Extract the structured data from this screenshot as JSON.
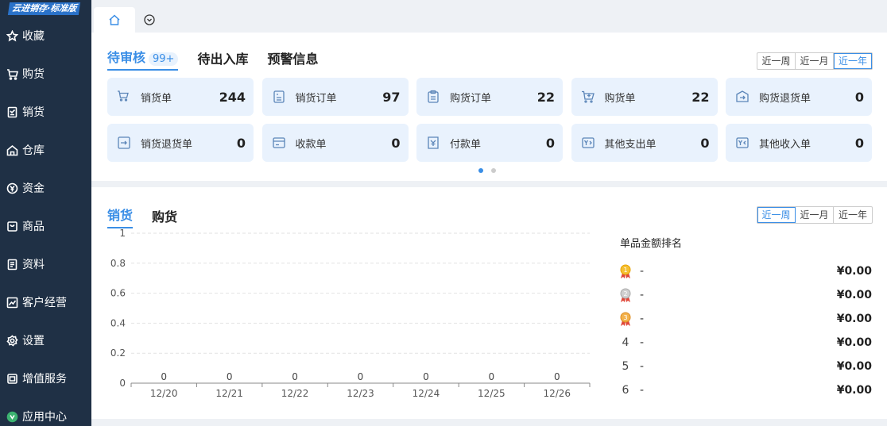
{
  "app": {
    "logo": "云进销存·标准版"
  },
  "sidebar": {
    "items": [
      {
        "label": "收藏",
        "icon": "star-icon"
      },
      {
        "label": "购货",
        "icon": "cart-icon"
      },
      {
        "label": "销货",
        "icon": "sales-doc-icon"
      },
      {
        "label": "仓库",
        "icon": "warehouse-icon"
      },
      {
        "label": "资金",
        "icon": "yen-icon"
      },
      {
        "label": "商品",
        "icon": "goods-icon"
      },
      {
        "label": "资料",
        "icon": "data-icon"
      },
      {
        "label": "客户经营",
        "icon": "trend-icon"
      },
      {
        "label": "设置",
        "icon": "gear-icon"
      },
      {
        "label": "增值服务",
        "icon": "service-icon"
      },
      {
        "label": "应用中心",
        "icon": "app-center-icon"
      }
    ]
  },
  "top": {
    "tabs": [
      {
        "label": "待审核",
        "badge": "99+",
        "active": true
      },
      {
        "label": "待出入库",
        "badge": "",
        "active": false
      },
      {
        "label": "预警信息",
        "badge": "",
        "active": false
      }
    ],
    "range": [
      "近一周",
      "近一月",
      "近一年"
    ],
    "range_selected": 2,
    "tiles": [
      {
        "label": "销货单",
        "value": "244",
        "icon": "cart-icon"
      },
      {
        "label": "销货订单",
        "value": "97",
        "icon": "order-icon"
      },
      {
        "label": "购货订单",
        "value": "22",
        "icon": "clipboard-icon"
      },
      {
        "label": "购货单",
        "value": "22",
        "icon": "cart-plus-icon"
      },
      {
        "label": "购货退货单",
        "value": "0",
        "icon": "return-box-icon"
      },
      {
        "label": "销货退货单",
        "value": "0",
        "icon": "return-doc-icon"
      },
      {
        "label": "收款单",
        "value": "0",
        "icon": "wallet-icon"
      },
      {
        "label": "付款单",
        "value": "0",
        "icon": "payment-icon"
      },
      {
        "label": "其他支出单",
        "value": "0",
        "icon": "yen-out-icon"
      },
      {
        "label": "其他收入单",
        "value": "0",
        "icon": "yen-in-icon"
      }
    ]
  },
  "bottom": {
    "tabs": [
      {
        "label": "销货",
        "active": true
      },
      {
        "label": "购货",
        "active": false
      }
    ],
    "range": [
      "近一周",
      "近一月",
      "近一年"
    ],
    "range_selected": 0,
    "rank_title": "单品金额排名",
    "ranks": [
      {
        "rank": "1",
        "name": "-",
        "amount": "¥0.00",
        "medal": "gold"
      },
      {
        "rank": "2",
        "name": "-",
        "amount": "¥0.00",
        "medal": "silver"
      },
      {
        "rank": "3",
        "name": "-",
        "amount": "¥0.00",
        "medal": "bronze"
      },
      {
        "rank": "4",
        "name": "-",
        "amount": "¥0.00",
        "medal": ""
      },
      {
        "rank": "5",
        "name": "-",
        "amount": "¥0.00",
        "medal": ""
      },
      {
        "rank": "6",
        "name": "-",
        "amount": "¥0.00",
        "medal": ""
      }
    ]
  },
  "chart_data": {
    "type": "bar",
    "categories": [
      "12/20",
      "12/21",
      "12/22",
      "12/23",
      "12/24",
      "12/25",
      "12/26"
    ],
    "values": [
      0,
      0,
      0,
      0,
      0,
      0,
      0
    ],
    "ylim": [
      0,
      1
    ],
    "yticks": [
      "0",
      "0.2",
      "0.4",
      "0.6",
      "0.8",
      "1"
    ],
    "grid": true,
    "title": "",
    "xlabel": "",
    "ylabel": ""
  }
}
